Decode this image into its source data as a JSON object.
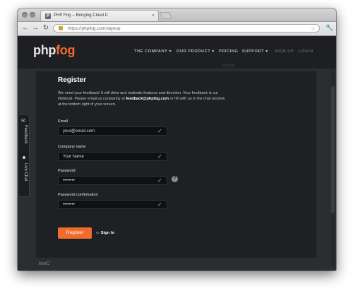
{
  "browser": {
    "tab_title": "PHP Fog -- Bringing Cloud C",
    "tab_close": "×",
    "url": "https://phpfog.com/signup",
    "back_icon": "back-arrow-icon",
    "forward_icon": "forward-arrow-icon",
    "reload_icon": "reload-icon",
    "star_icon": "star-icon",
    "wrench_icon": "wrench-icon",
    "back_glyph": "←",
    "forward_glyph": "→",
    "reload_glyph": "↻",
    "star_glyph": "☆",
    "wrench_glyph": "🔧"
  },
  "site": {
    "logo_main": "php",
    "logo_accent": "fog",
    "accent_color": "#ef6c2c",
    "nav": {
      "company": "THE COMPANY ▾",
      "product": "OUR PRODUCT ▾",
      "pricing": "PRICING",
      "support": "SUPPORT ▾",
      "signup": "SIGN UP",
      "login": "LOGIN"
    }
  },
  "register": {
    "title": "Register",
    "intro_pre": "We need your feedback! It will drive and motivate features and direction. Your feedback is our lifeblood. Please email us constantly at ",
    "intro_email": "feedback@phpfog.com",
    "intro_post": " or IM with us in the chat window at the bottom right of your screen.",
    "fields": {
      "email_label": "Email",
      "email_value": "your@email.com",
      "company_label": "Company name",
      "company_value": "Your Name",
      "password_label": "Password",
      "password_value": "••••••••",
      "confirm_label": "Password confirmation",
      "confirm_value": "••••••••"
    },
    "check_glyph": "✓",
    "help_glyph": "?",
    "button": "Register",
    "or_text": "or ",
    "signin_link": "Sign In"
  },
  "side_tab": {
    "feedback": "Feedback",
    "live_chat": "Live Chat"
  },
  "footer_fragment": "InoC"
}
